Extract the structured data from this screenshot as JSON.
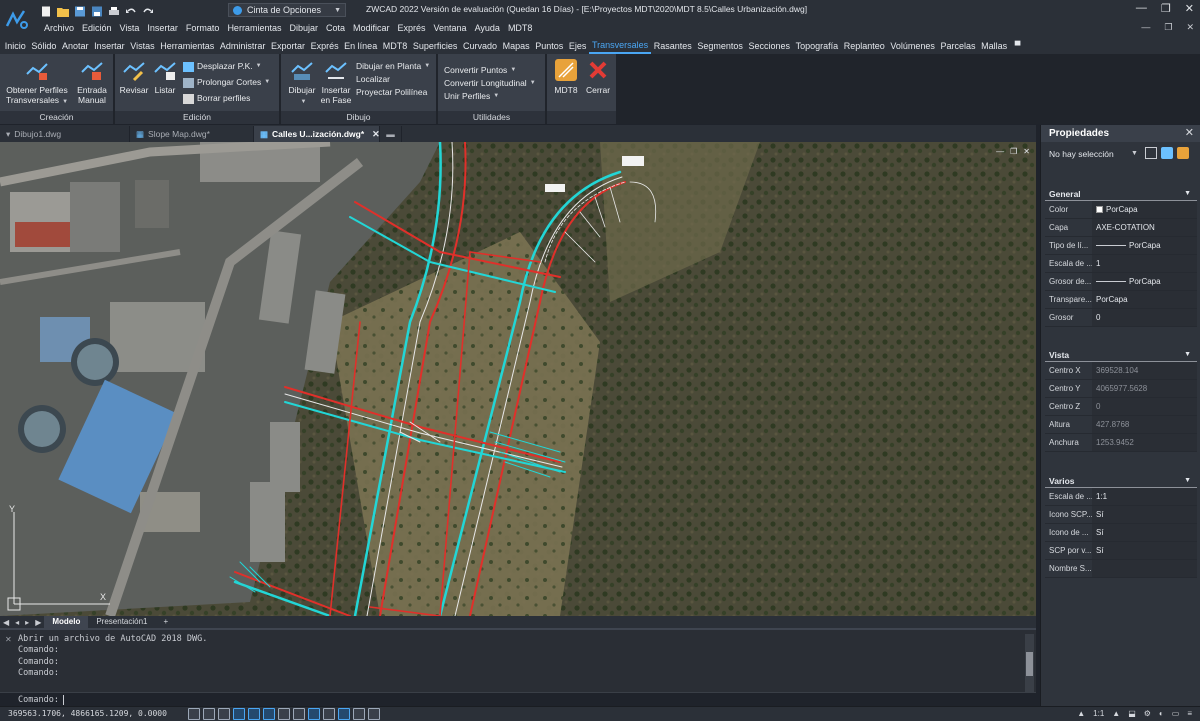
{
  "app": {
    "window_title": "ZWCAD 2022 Versión de evaluación (Quedan 16 Días) - [E:\\Proyectos MDT\\2020\\MDT 8.5\\Calles Urbanización.dwg]",
    "workspace": "Cinta de Opciones",
    "win_min": "—",
    "win_max": "❐",
    "win_close": "✕"
  },
  "menu": [
    "Archivo",
    "Edición",
    "Vista",
    "Insertar",
    "Formato",
    "Herramientas",
    "Dibujar",
    "Cota",
    "Modificar",
    "Exprés",
    "Ventana",
    "Ayuda",
    "MDT8"
  ],
  "ribbon_tabs": [
    "Inicio",
    "Sólido",
    "Anotar",
    "Insertar",
    "Vistas",
    "Herramientas",
    "Administrar",
    "Exportar",
    "Exprés",
    "En línea",
    "MDT8",
    "Superficies",
    "Curvado",
    "Mapas",
    "Puntos",
    "Ejes",
    "Transversales",
    "Rasantes",
    "Segmentos",
    "Secciones",
    "Topografía",
    "Replanteo",
    "Volúmenes",
    "Parcelas",
    "Mallas"
  ],
  "ribbon_active_tab": "Transversales",
  "ribbon": {
    "creacion": {
      "title": "Creación",
      "obtener": "Obtener Perfiles",
      "obtener2": "Transversales",
      "entrada": "Entrada",
      "entrada2": "Manual"
    },
    "edicion": {
      "title": "Edición",
      "revisar": "Revisar",
      "listar": "Listar",
      "desplazar": "Desplazar P.K.",
      "prolongar": "Prolongar Cortes",
      "borrar": "Borrar perfiles"
    },
    "dibujo": {
      "title": "Dibujo",
      "dibujar": "Dibujar",
      "insertar": "Insertar",
      "insertar2": "en Fase",
      "planta": "Dibujar en Planta",
      "localizar": "Localizar",
      "proyectar": "Proyectar Polilínea"
    },
    "utilidades": {
      "title": "Utilidades",
      "convertir_puntos": "Convertir Puntos",
      "convertir_long": "Convertir Longitudinal",
      "unir": "Unir Perfiles"
    },
    "extra": {
      "mdt8": "MDT8",
      "cerrar": "Cerrar"
    }
  },
  "doc_tabs": [
    {
      "label": "Dibujo1.dwg"
    },
    {
      "label": "Slope Map.dwg*"
    },
    {
      "label": "Calles U...ización.dwg*"
    }
  ],
  "layout_tabs": [
    "Modelo",
    "Presentación1",
    "+"
  ],
  "command": {
    "history": "Abrir un archivo de AutoCAD 2018 DWG.\nComando:\nComando:\nComando:",
    "prompt": "Comando:"
  },
  "status": {
    "coords": "369563.1706, 4866165.1209, 0.0000",
    "scale": "1:1"
  },
  "properties": {
    "title": "Propiedades",
    "selection": "No hay selección",
    "general_title": "General",
    "general": [
      {
        "k": "Color",
        "v": "PorCapa"
      },
      {
        "k": "Capa",
        "v": "AXE-COTATION"
      },
      {
        "k": "Tipo de lí...",
        "v": "PorCapa"
      },
      {
        "k": "Escala de ...",
        "v": "1"
      },
      {
        "k": "Grosor de...",
        "v": "PorCapa"
      },
      {
        "k": "Transpare...",
        "v": "PorCapa"
      },
      {
        "k": "Grosor",
        "v": "0"
      }
    ],
    "vista_title": "Vista",
    "vista": [
      {
        "k": "Centro X",
        "v": "369528.104"
      },
      {
        "k": "Centro Y",
        "v": "4065977.5628"
      },
      {
        "k": "Centro Z",
        "v": "0"
      },
      {
        "k": "Altura",
        "v": "427.8768"
      },
      {
        "k": "Anchura",
        "v": "1253.9452"
      }
    ],
    "varios_title": "Varios",
    "varios": [
      {
        "k": "Escala de ...",
        "v": "1:1"
      },
      {
        "k": "Icono SCP...",
        "v": "Sí"
      },
      {
        "k": "Icono de ...",
        "v": "Sí"
      },
      {
        "k": "SCP por v...",
        "v": "Sí"
      },
      {
        "k": "Nombre S...",
        "v": ""
      }
    ]
  },
  "colors": {
    "accent": "#4aa6f3",
    "road_edge_red": "#e0302a",
    "slope_cyan": "#22d6d6"
  }
}
